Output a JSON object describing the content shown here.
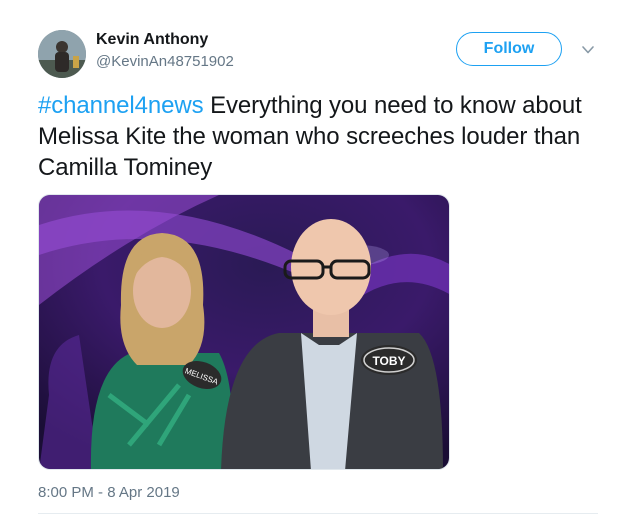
{
  "author": {
    "name": "Kevin Anthony",
    "handle": "@KevinAn48751902"
  },
  "follow_button": {
    "label": "Follow"
  },
  "tweet": {
    "hashtag": "#channel4news",
    "text": " Everything you need to know about Melissa Kite the woman who screeches louder than Camilla Tominey"
  },
  "photo": {
    "badge_left": "MELISSA",
    "badge_right": "TOBY"
  },
  "timestamp": "8:00 PM - 8 Apr 2019",
  "colors": {
    "accent": "#1da1f2",
    "text": "#14171a",
    "muted": "#657786"
  }
}
